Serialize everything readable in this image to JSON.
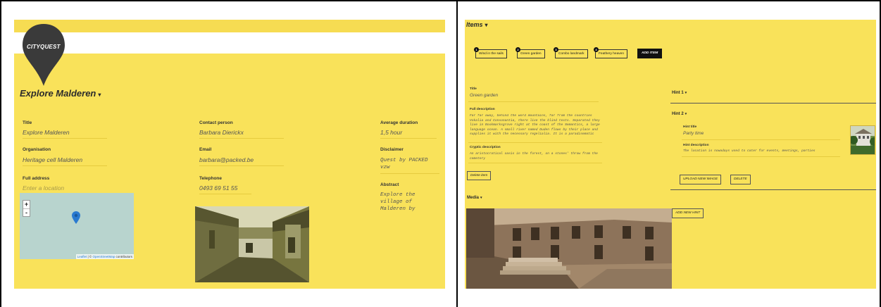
{
  "left": {
    "brand": "CITYQUEST",
    "page_title": "Explore Malderen",
    "caret": "▾",
    "fields": {
      "title_label": "Title",
      "title_value": "Explore Malderen",
      "organisation_label": "Organisation",
      "organisation_value": "Heritage cell Malderen",
      "address_label": "Full address",
      "address_placeholder": "Enter a location",
      "contact_label": "Contact person",
      "contact_value": "Barbara Dierickx",
      "email_label": "Email",
      "email_value": "barbara@packed.be",
      "telephone_label": "Telephone",
      "telephone_value": "0493 69 51 55",
      "duration_label": "Average duration",
      "duration_value": "1,5 hour",
      "disclaimer_label": "Disclaimer",
      "disclaimer_value": "Quest by PACKED vzw",
      "abstract_label": "Abstract",
      "abstract_value": "Explore the village of Malderen by"
    },
    "map": {
      "zoom_in": "+",
      "zoom_out": "-",
      "attribution_leaflet": "Leaflet",
      "attribution_sep": " | © ",
      "attribution_osm": "OpenStreetMap",
      "attribution_tail": " contributors"
    }
  },
  "right": {
    "items_title": "Items",
    "caret": "▾",
    "items": [
      {
        "num": "1",
        "label": "Wind in the sails"
      },
      {
        "num": "2",
        "label": "Green garden"
      },
      {
        "num": "3",
        "label": "Combo landmark"
      },
      {
        "num": "4",
        "label": "Feathery heaven"
      }
    ],
    "add_item": "ADD ITEM",
    "title_label": "Title",
    "title_value": "Green garden",
    "full_desc_label": "Full description",
    "full_desc_value": "Far far away, behind the word mountains, far from the countries Vokalia and Consonantia, there live the blind texts. Separated they live in Bookmarksgrove right at the coast of the Semantics, a large language ocean. A small river named Duden flows by their place and supplies it with the necessary regelialia. It is a paradisematic",
    "cryptic_label": "Cryptic description",
    "cryptic_value": "An aristocratical oasis in the forest, on a stones' throw from the cemetery",
    "delete_item": "Delete item",
    "media_label": "Media",
    "hint1": "Hint 1",
    "hint2": "Hint 2",
    "hint_title_label": "Hint title",
    "hint_title_value": "Party time",
    "hint_desc_label": "Hint description",
    "hint_desc_value": "The location is nowadays used to cater for events, meetings, parties",
    "upload_image": "UPLOAD NEW IMAGE",
    "delete": "DELETE",
    "add_hint": "ADD NEW HINT"
  },
  "colors": {
    "panel_yellow": "#f9e25a",
    "accent_black": "#111111",
    "map_water": "#b8d4ce",
    "marker_blue": "#2a7ad0"
  }
}
